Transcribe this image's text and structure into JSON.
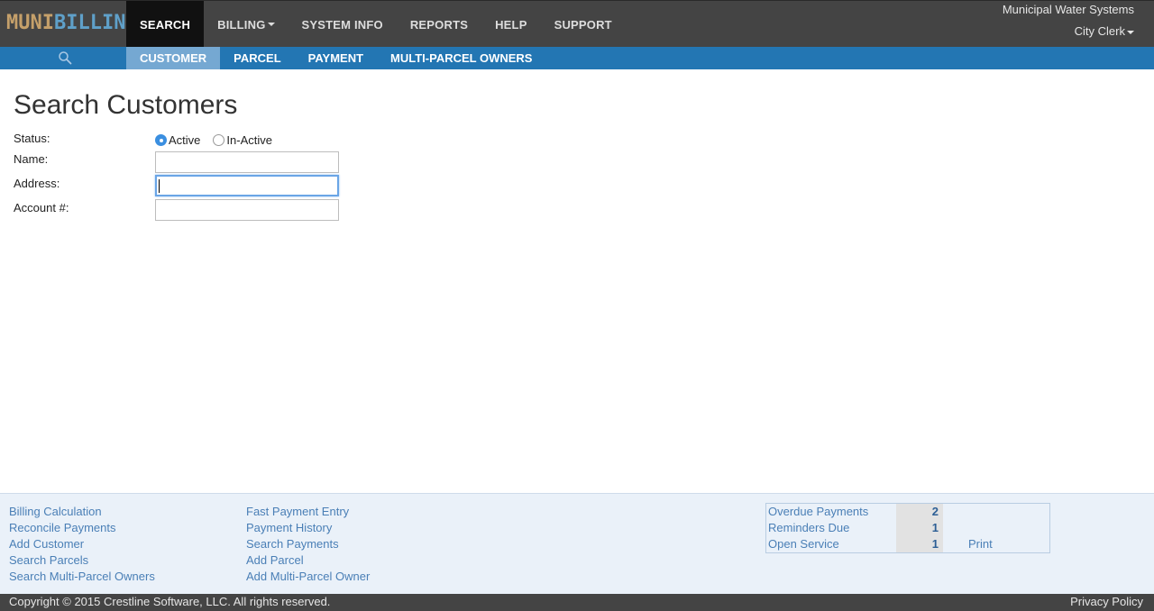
{
  "header": {
    "logo_muni": "MUNI",
    "logo_billing": "BILLING",
    "org_name": "Municipal Water Systems",
    "user_menu": "City Clerk",
    "nav": [
      {
        "label": "SEARCH"
      },
      {
        "label": "BILLING"
      },
      {
        "label": "SYSTEM INFO"
      },
      {
        "label": "REPORTS"
      },
      {
        "label": "HELP"
      },
      {
        "label": "SUPPORT"
      }
    ]
  },
  "subnav": {
    "search_icon": "search-icon",
    "items": [
      {
        "label": "CUSTOMER"
      },
      {
        "label": "PARCEL"
      },
      {
        "label": "PAYMENT"
      },
      {
        "label": "MULTI-PARCEL OWNERS"
      }
    ]
  },
  "main": {
    "title": "Search Customers",
    "status_label": "Status:",
    "status_options": [
      {
        "label": "Active",
        "checked": true
      },
      {
        "label": "In-Active",
        "checked": false
      }
    ],
    "name_label": "Name:",
    "name_value": "",
    "address_label": "Address:",
    "address_value": "",
    "account_label": "Account #:",
    "account_value": ""
  },
  "footer": {
    "links_col1": [
      "Billing Calculation",
      "Reconcile Payments",
      "Add Customer",
      "Search Parcels",
      "Search Multi-Parcel Owners"
    ],
    "links_col2": [
      "Fast Payment Entry",
      "Payment History",
      "Search Payments",
      "Add Parcel",
      "Add Multi-Parcel Owner"
    ],
    "stats": [
      {
        "label": "Overdue Payments",
        "value": "2"
      },
      {
        "label": "Reminders Due",
        "value": "1"
      },
      {
        "label": "Open Service",
        "value": "1"
      }
    ],
    "print_label": "Print",
    "copyright": "Copyright © 2015 Crestline Software, LLC. All rights reserved.",
    "privacy": "Privacy Policy"
  },
  "colors": {
    "topbar": "#444444",
    "subbar": "#2376b3",
    "subnav_active": "#75a8d2",
    "link": "#4a7fb6",
    "radio_accent": "#3b8fe0"
  }
}
